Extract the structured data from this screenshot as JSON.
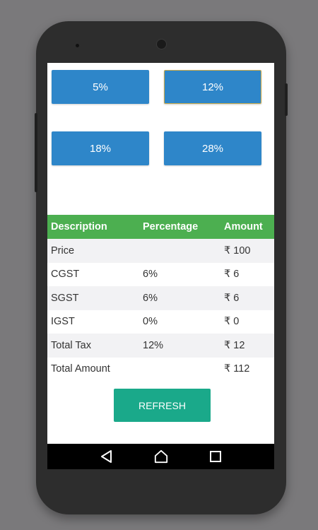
{
  "rate_buttons": [
    {
      "label": "5%",
      "selected": false
    },
    {
      "label": "12%",
      "selected": true
    },
    {
      "label": "18%",
      "selected": false
    },
    {
      "label": "28%",
      "selected": false
    }
  ],
  "table": {
    "headers": [
      "Description",
      "Percentage",
      "Amount"
    ],
    "rows": [
      {
        "description": "Price",
        "percentage": "",
        "amount": "₹ 100"
      },
      {
        "description": "CGST",
        "percentage": "6%",
        "amount": "₹ 6"
      },
      {
        "description": "SGST",
        "percentage": "6%",
        "amount": "₹ 6"
      },
      {
        "description": "IGST",
        "percentage": "0%",
        "amount": "₹ 0"
      },
      {
        "description": "Total Tax",
        "percentage": "12%",
        "amount": "₹ 12"
      },
      {
        "description": "Total Amount",
        "percentage": "",
        "amount": "₹ 112"
      }
    ]
  },
  "refresh_label": "REFRESH",
  "nav": {
    "back_icon": "back-triangle-icon",
    "home_icon": "home-icon",
    "recents_icon": "recents-square-icon"
  },
  "colors": {
    "rate_button": "#2e86c9",
    "header_green": "#4caf50",
    "refresh_teal": "#1aa98a",
    "selected_border": "#c8a94a"
  }
}
